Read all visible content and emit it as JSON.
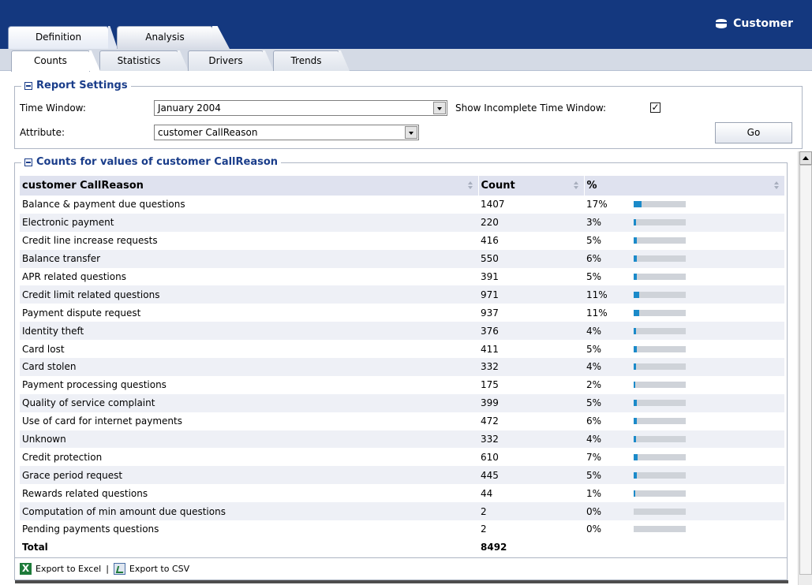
{
  "header": {
    "title": "Customer",
    "title_icon": "database-icon",
    "tabs": [
      {
        "label": "Definition",
        "active": false
      },
      {
        "label": "Analysis",
        "active": true
      }
    ]
  },
  "subtabs": [
    {
      "label": "Counts",
      "active": true
    },
    {
      "label": "Statistics",
      "active": false
    },
    {
      "label": "Drivers",
      "active": false
    },
    {
      "label": "Trends",
      "active": false
    }
  ],
  "report_settings": {
    "title": "Report Settings",
    "time_window_label": "Time Window:",
    "time_window_value": "January 2004",
    "attribute_label": "Attribute:",
    "attribute_value": "customer CallReason",
    "show_incomplete_label": "Show Incomplete Time Window:",
    "show_incomplete_checked": "✓",
    "go_label": "Go"
  },
  "counts": {
    "title": "Counts for values of customer CallReason",
    "columns": [
      "customer CallReason",
      "Count",
      "%"
    ],
    "rows": [
      {
        "name": "Balance & payment due questions",
        "count": "1407",
        "pct": "17%",
        "pct_value": 17
      },
      {
        "name": "Electronic payment",
        "count": "220",
        "pct": "3%",
        "pct_value": 3
      },
      {
        "name": "Credit line increase requests",
        "count": "416",
        "pct": "5%",
        "pct_value": 5
      },
      {
        "name": "Balance transfer",
        "count": "550",
        "pct": "6%",
        "pct_value": 6
      },
      {
        "name": "APR related questions",
        "count": "391",
        "pct": "5%",
        "pct_value": 5
      },
      {
        "name": "Credit limit related questions",
        "count": "971",
        "pct": "11%",
        "pct_value": 11
      },
      {
        "name": "Payment dispute request",
        "count": "937",
        "pct": "11%",
        "pct_value": 11
      },
      {
        "name": "Identity theft",
        "count": "376",
        "pct": "4%",
        "pct_value": 4
      },
      {
        "name": "Card lost",
        "count": "411",
        "pct": "5%",
        "pct_value": 5
      },
      {
        "name": "Card stolen",
        "count": "332",
        "pct": "4%",
        "pct_value": 4
      },
      {
        "name": "Payment processing questions",
        "count": "175",
        "pct": "2%",
        "pct_value": 2
      },
      {
        "name": "Quality of service complaint",
        "count": "399",
        "pct": "5%",
        "pct_value": 5
      },
      {
        "name": "Use of card for internet payments",
        "count": "472",
        "pct": "6%",
        "pct_value": 6
      },
      {
        "name": "Unknown",
        "count": "332",
        "pct": "4%",
        "pct_value": 4
      },
      {
        "name": "Credit protection",
        "count": "610",
        "pct": "7%",
        "pct_value": 7
      },
      {
        "name": "Grace period request",
        "count": "445",
        "pct": "5%",
        "pct_value": 5
      },
      {
        "name": "Rewards related questions",
        "count": "44",
        "pct": "1%",
        "pct_value": 1
      },
      {
        "name": "Computation of min amount due questions",
        "count": "2",
        "pct": "0%",
        "pct_value": 0
      },
      {
        "name": "Pending payments questions",
        "count": "2",
        "pct": "0%",
        "pct_value": 0
      }
    ],
    "total_label": "Total",
    "total_count": "8492",
    "bar_fill_color": "#1b8ac9",
    "bar_track_color": "#cfd3d9"
  },
  "footer": {
    "export_excel": "Export to Excel",
    "separator": "|",
    "export_csv": "Export to CSV"
  }
}
